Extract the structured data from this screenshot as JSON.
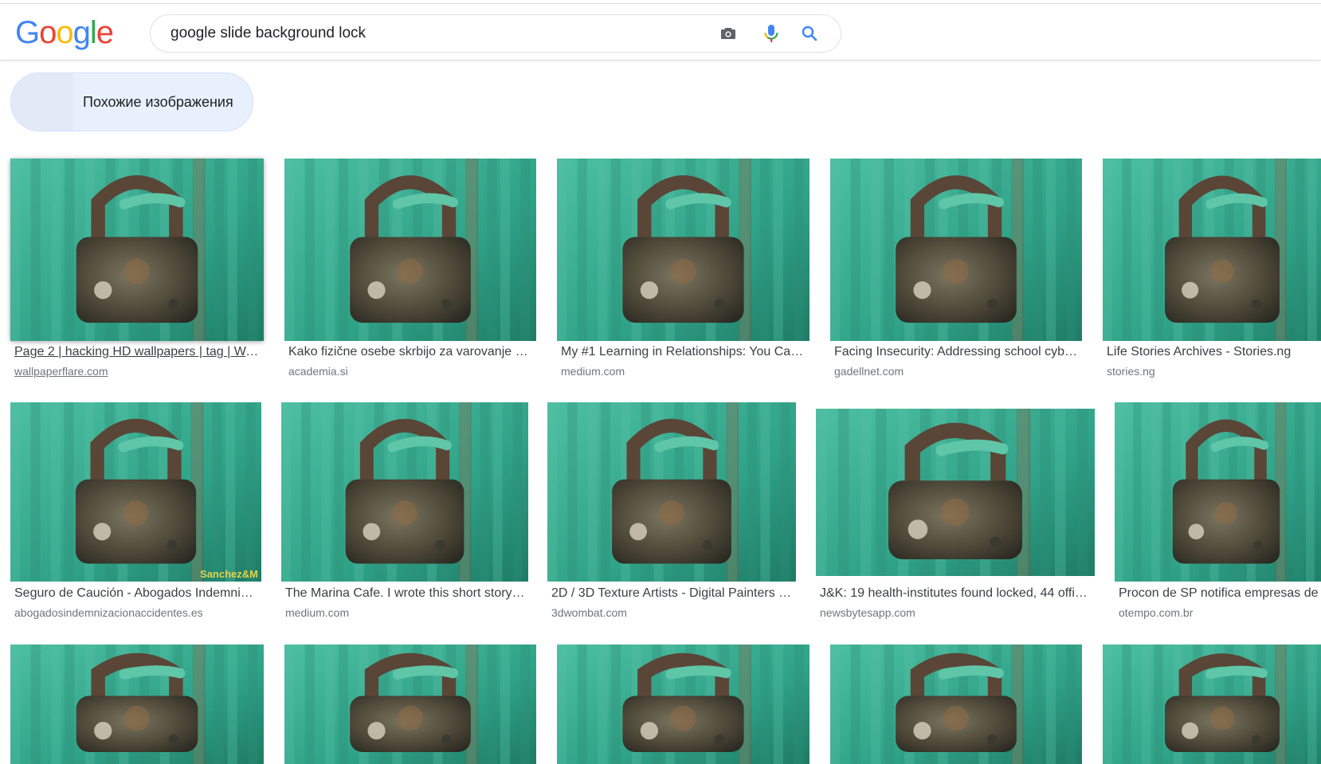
{
  "logo": {
    "letters": [
      {
        "char": "G",
        "color": "#4285f4"
      },
      {
        "char": "o",
        "color": "#ea4335"
      },
      {
        "char": "o",
        "color": "#fbbc05"
      },
      {
        "char": "g",
        "color": "#4285f4"
      },
      {
        "char": "l",
        "color": "#34a853"
      },
      {
        "char": "e",
        "color": "#ea4335"
      }
    ]
  },
  "search": {
    "query": "google slide background lock"
  },
  "chip": {
    "label": "Похожие изображения"
  },
  "results": [
    {
      "title": "Page 2 | hacking HD wallpapers | tag | Wall...",
      "source": "wallpaperflare.com"
    },
    {
      "title": "Kako fizične osebe skrbijo za varovanje sv...",
      "source": "academia.si"
    },
    {
      "title": "My #1 Learning in Relationships: You Can ...",
      "source": "medium.com"
    },
    {
      "title": "Facing Insecurity: Addressing school cyber...",
      "source": "gadellnet.com"
    },
    {
      "title": "Life Stories Archives - Stories.ng",
      "source": "stories.ng"
    },
    {
      "title": "Seguro de Caución - Abogados Indemniza...",
      "source": "abogadosindemnizacionaccidentes.es",
      "watermark": "Sanchez&M"
    },
    {
      "title": "The Marina Cafe. I wrote this short story ...",
      "source": "medium.com"
    },
    {
      "title": "2D / 3D Texture Artists - Digital Painters | ...",
      "source": "3dwombat.com"
    },
    {
      "title": "J&K: 19 health-institutes found locked, 44 offici...",
      "source": "newsbytesapp.com"
    },
    {
      "title": "Procon de SP notifica empresas de te",
      "source": "otempo.com.br"
    },
    {
      "title": "",
      "source": ""
    },
    {
      "title": "",
      "source": ""
    },
    {
      "title": "",
      "source": ""
    },
    {
      "title": "",
      "source": ""
    },
    {
      "title": "",
      "source": ""
    }
  ],
  "colors": {
    "accent": "#4285f4",
    "chip_bg": "#e8f0fe",
    "wood_green": "#3fae94",
    "rust": "#6b4a34"
  }
}
